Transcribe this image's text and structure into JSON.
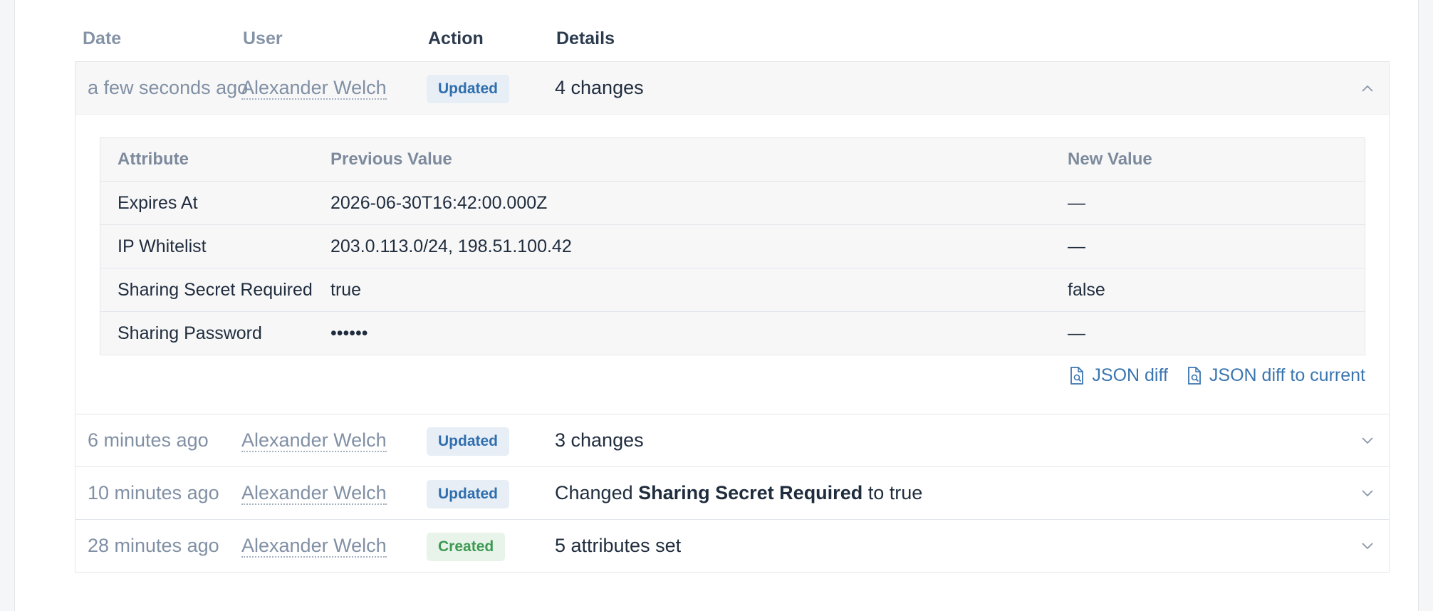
{
  "columns": {
    "date": "Date",
    "user": "User",
    "action": "Action",
    "details": "Details"
  },
  "rows": [
    {
      "date": "a few seconds ago",
      "user": "Alexander Welch",
      "action": "Updated",
      "details": "4 changes",
      "expanded": true
    },
    {
      "date": "6 minutes ago",
      "user": "Alexander Welch",
      "action": "Updated",
      "details": "3 changes",
      "expanded": false
    },
    {
      "date": "10 minutes ago",
      "user": "Alexander Welch",
      "action": "Updated",
      "details_prefix": "Changed ",
      "details_bold": "Sharing Secret Required",
      "details_suffix": " to true",
      "expanded": false
    },
    {
      "date": "28 minutes ago",
      "user": "Alexander Welch",
      "action": "Created",
      "details": "5 attributes set",
      "expanded": false
    }
  ],
  "changes": {
    "headers": {
      "attribute": "Attribute",
      "previous": "Previous Value",
      "new": "New Value"
    },
    "items": [
      {
        "attribute": "Expires At",
        "previous": "2026-06-30T16:42:00.000Z",
        "new": "—"
      },
      {
        "attribute": "IP Whitelist",
        "previous": "203.0.113.0/24, 198.51.100.42",
        "new": "—"
      },
      {
        "attribute": "Sharing Secret Required",
        "previous": "true",
        "new": "false"
      },
      {
        "attribute": "Sharing Password",
        "previous": "••••••",
        "new": "—"
      }
    ]
  },
  "links": {
    "json_diff": "JSON diff",
    "json_diff_current": "JSON diff to current"
  },
  "colors": {
    "updated_badge": "#2f6fae",
    "created_badge": "#3e9a52",
    "link": "#3a75b0"
  },
  "icons": {
    "collapse": "chevron-up-icon",
    "expand": "chevron-down-icon",
    "file": "file-search-icon"
  }
}
